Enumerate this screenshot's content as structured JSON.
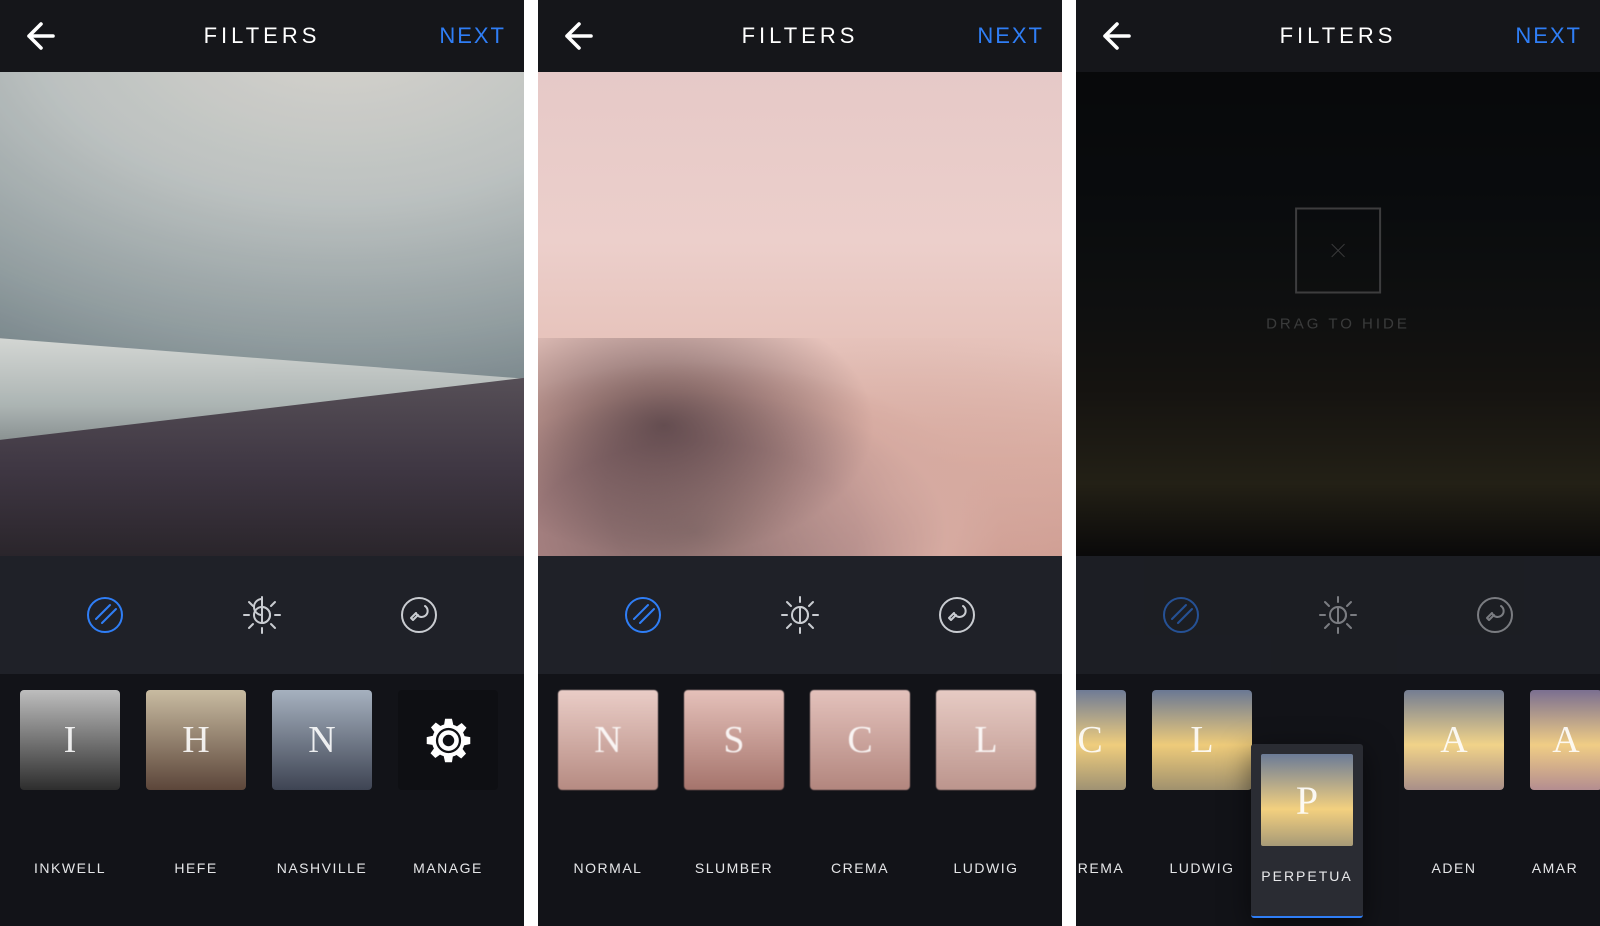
{
  "colors": {
    "accent": "#2f7ef6",
    "bg_dark": "#1a1b1f",
    "toolbar": "#1f2128"
  },
  "header": {
    "title": "FILTERS",
    "next": "NEXT"
  },
  "drag_overlay": {
    "label": "DRAG TO HIDE"
  },
  "tools": [
    {
      "name": "filters",
      "active": true
    },
    {
      "name": "lux",
      "active": false
    },
    {
      "name": "edit-tools",
      "active": false
    }
  ],
  "screens": [
    {
      "id": "beach",
      "filters": [
        {
          "letter": "I",
          "label": "INKWELL",
          "theme": "bw"
        },
        {
          "letter": "H",
          "label": "HEFE",
          "theme": "warm"
        },
        {
          "letter": "N",
          "label": "NASHVILLE",
          "theme": "cool"
        },
        {
          "letter": "",
          "label": "MANAGE",
          "theme": "gear",
          "is_manage": true
        }
      ]
    },
    {
      "id": "clouds",
      "filters": [
        {
          "letter": "N",
          "label": "NORMAL",
          "theme": "pink1"
        },
        {
          "letter": "S",
          "label": "SLUMBER",
          "theme": "pink2"
        },
        {
          "letter": "C",
          "label": "CREMA",
          "theme": "pink3"
        },
        {
          "letter": "L",
          "label": "LUDWIG",
          "theme": "pink4"
        }
      ]
    },
    {
      "id": "dusk",
      "dragged": {
        "letter": "P",
        "label": "PERPETUA"
      },
      "filters": [
        {
          "letter": "C",
          "label": "REMA",
          "theme": "d1",
          "partial": "left"
        },
        {
          "letter": "L",
          "label": "LUDWIG",
          "theme": "d2"
        },
        {
          "letter": "A",
          "label": "ADEN",
          "theme": "d3"
        },
        {
          "letter": "A",
          "label": "AMAR",
          "theme": "d4",
          "partial": "right"
        }
      ]
    }
  ]
}
